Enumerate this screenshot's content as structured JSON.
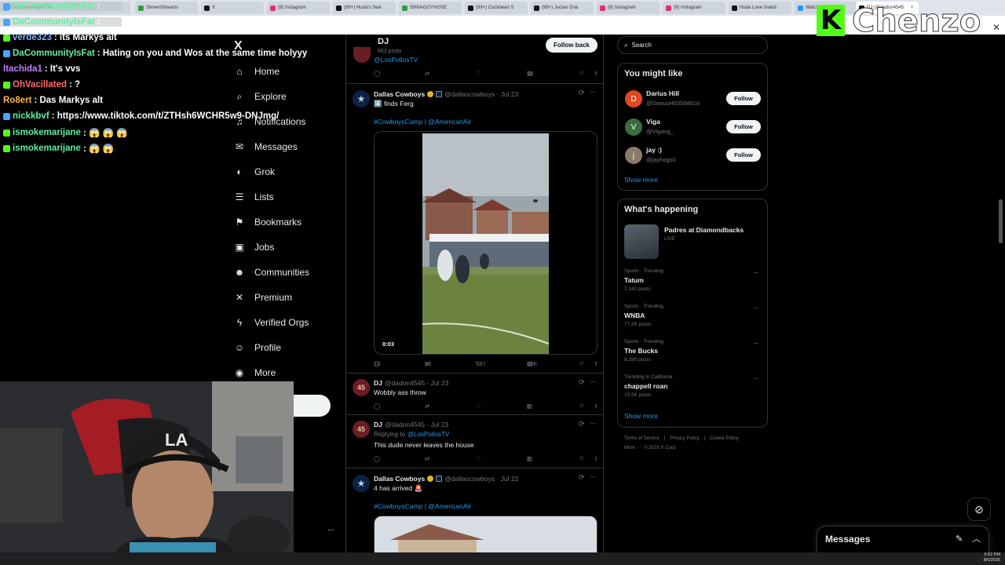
{
  "browser": {
    "tabs": [
      {
        "label": "DaCommunityIsFat",
        "color": "#1d9bf0"
      },
      {
        "label": "StevenStreams",
        "color": "#2ea043"
      },
      {
        "label": "X",
        "color": "#111111"
      },
      {
        "label": "(8) Instagram",
        "color": "#e1306c"
      },
      {
        "label": "(99+) Huda's Swe",
        "color": "#111111"
      },
      {
        "label": "SHNAGGYHOSE",
        "color": "#2ea043"
      },
      {
        "label": "(99+) Cuckbean S",
        "color": "#111111"
      },
      {
        "label": "(99+) Jucian Grai",
        "color": "#111111"
      },
      {
        "label": "(8) Instagram",
        "color": "#e1306c"
      },
      {
        "label": "(8) Instagram",
        "color": "#e1306c"
      },
      {
        "label": "Huda Love Island",
        "color": "#111111"
      },
      {
        "label": "Watch Isle Sub",
        "color": "#1d9bf0"
      },
      {
        "label": "DJ (@dadon4545",
        "color": "#111111"
      }
    ],
    "new_tab_symbol": "+"
  },
  "chat": {
    "lines": [
      {
        "user": "DaCommunityIsFat",
        "user_color": "#5ff0a0",
        "text": ":",
        "badge": "#4aa3ff"
      },
      {
        "user": "DaCommunityIsFat",
        "user_color": "#5ff0a0",
        "text": ":",
        "badge": "#4aa3ff"
      },
      {
        "user": "verde323",
        "user_color": "#7fb3ff",
        "text": ": its Markys alt",
        "badge": "#53fc18"
      },
      {
        "user": "DaCommunityIsFat",
        "user_color": "#5ff0a0",
        "text": ": Hating on you and Wos at the same time holyyy",
        "badge": "#4aa3ff"
      },
      {
        "user": "Itachida1",
        "user_color": "#c77dff",
        "text": ": It's vvs",
        "badge": ""
      },
      {
        "user": "OhVacillated",
        "user_color": "#ff6b6b",
        "text": ": ?",
        "badge": "#53fc18"
      },
      {
        "user": "Ro8ert",
        "user_color": "#ffb347",
        "text": ": Das Markys alt",
        "badge": ""
      },
      {
        "user": "nickkbvf",
        "user_color": "#5ff0a0",
        "text": ": https://www.tiktok.com/t/ZTHsh6WCHR5w9-DNJmg/",
        "badge": "#4aa3ff"
      },
      {
        "user": "ismokemarijane",
        "user_color": "#5ff0a0",
        "text": ": 😱 😱 😱",
        "badge": "#53fc18"
      },
      {
        "user": "ismokemarijane",
        "user_color": "#5ff0a0",
        "text": ": 😱 😱",
        "badge": "#53fc18"
      }
    ]
  },
  "overlay": {
    "brand": "Chenzo",
    "brand_letter": "K"
  },
  "nav": {
    "logo": "X",
    "items": [
      {
        "label": "Home",
        "icon": "home-icon",
        "glyph": "⌂"
      },
      {
        "label": "Explore",
        "icon": "search-icon",
        "glyph": "⌕"
      },
      {
        "label": "Notifications",
        "icon": "bell-icon",
        "glyph": "♫"
      },
      {
        "label": "Messages",
        "icon": "mail-icon",
        "glyph": "✉"
      },
      {
        "label": "Grok",
        "icon": "grok-icon",
        "glyph": "◐"
      },
      {
        "label": "Lists",
        "icon": "list-icon",
        "glyph": "☰"
      },
      {
        "label": "Bookmarks",
        "icon": "bookmark-icon",
        "glyph": "⚑"
      },
      {
        "label": "Jobs",
        "icon": "briefcase-icon",
        "glyph": "▣"
      },
      {
        "label": "Communities",
        "icon": "people-icon",
        "glyph": "☻"
      },
      {
        "label": "Premium",
        "icon": "x-logo-icon",
        "glyph": "✕"
      },
      {
        "label": "Verified Orgs",
        "icon": "lightning-icon",
        "glyph": "ϟ"
      },
      {
        "label": "Profile",
        "icon": "person-icon",
        "glyph": "☺"
      },
      {
        "label": "More",
        "icon": "more-circle-icon",
        "glyph": "◉"
      }
    ],
    "more_dots": "..."
  },
  "profile_header": {
    "name": "DJ",
    "posts": "663 posts",
    "follow_back": "Follow back"
  },
  "tweets": [
    {
      "id": "prev",
      "handle_link": "@LosPollosTV",
      "views": "10"
    },
    {
      "id": "t1",
      "name": "Dallas Cowboys",
      "handle": "@dallascowboys · Jul 23",
      "text": "4️⃣ finds Ferg",
      "tags": "#CowboysCamp | @AmericanAir",
      "video_time": "0:03",
      "replies": "18",
      "reposts": "50",
      "likes": "537",
      "views": "28K"
    },
    {
      "id": "t2",
      "name": "DJ",
      "handle": "@dadon4545 · Jul 23",
      "text": "Wobbly ass throw",
      "views": "6",
      "avatar_text": "45"
    },
    {
      "id": "t3",
      "name": "DJ",
      "handle": "@dadon4545 · Jul 23",
      "replying": "Replying to",
      "replying_link": "@LosPollosTV",
      "text": "This dude never leaves the house",
      "views": "3",
      "avatar_text": "45"
    },
    {
      "id": "t4",
      "name": "Dallas Cowboys",
      "handle": "@dallascowboys · Jul 22",
      "text": "4 has arrived 🚨",
      "tags": "#CowboysCamp | @AmericanAir"
    }
  ],
  "search": {
    "placeholder": "Search"
  },
  "suggestions": {
    "title": "You might like",
    "people": [
      {
        "name": "Darius Hill",
        "handle": "@DariusH53568616",
        "avatar_color": "#e0481f",
        "initial": "D",
        "button": "Follow"
      },
      {
        "name": "Viga",
        "handle": "@Vigavg_",
        "avatar_color": "#3b6b3f",
        "initial": "V",
        "button": "Follow"
      },
      {
        "name": "jay :)",
        "handle": "@jayhogs0",
        "avatar_color": "#8a7a6a",
        "initial": "j",
        "button": "Follow"
      }
    ],
    "show_more": "Show more"
  },
  "happening": {
    "title": "What's happening",
    "live": {
      "title": "Padres at Diamondbacks",
      "status": "LIVE"
    },
    "trends": [
      {
        "meta": "Sports · Trending",
        "title": "Tatum",
        "posts": "7,142 posts"
      },
      {
        "meta": "Sports · Trending",
        "title": "WNBA",
        "posts": "77.2K posts"
      },
      {
        "meta": "Sports · Trending",
        "title": "The Bucks",
        "posts": "8,280 posts"
      },
      {
        "meta": "Trending in California",
        "title": "chappell roan",
        "posts": "15.5K posts"
      }
    ],
    "show_more": "Show more"
  },
  "footer": {
    "links": [
      "Terms of Service",
      "Privacy Policy",
      "Cookie Policy"
    ],
    "more": "More ···",
    "copyright": "© 2025 X Corp."
  },
  "messages_drawer": {
    "title": "Messages"
  },
  "taskbar": {
    "time": "6:52 PM",
    "date": "8/6/2025"
  },
  "colors": {
    "accent": "#1d9bf0",
    "border": "#2f3336",
    "muted": "#71767b",
    "kick_green": "#53fc18"
  }
}
